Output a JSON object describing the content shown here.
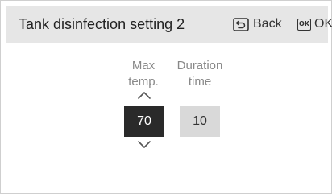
{
  "header": {
    "title": "Tank disinfection setting 2",
    "back_label": "Back",
    "ok_icon_text": "OK",
    "ok_label": "OK"
  },
  "settings": {
    "max_temp": {
      "label": "Max\ntemp.",
      "value": "70",
      "selected": true
    },
    "duration_time": {
      "label": "Duration\ntime",
      "value": "10",
      "selected": false
    }
  },
  "icons": {
    "back": "return-arrow-icon",
    "ok": "ok-key-icon",
    "up": "chevron-up-icon",
    "down": "chevron-down-icon"
  },
  "colors": {
    "header_bg": "#e6e6e6",
    "selected_bg": "#2a2a2a",
    "unselected_bg": "#d9d9d9",
    "label_text": "#888888"
  }
}
